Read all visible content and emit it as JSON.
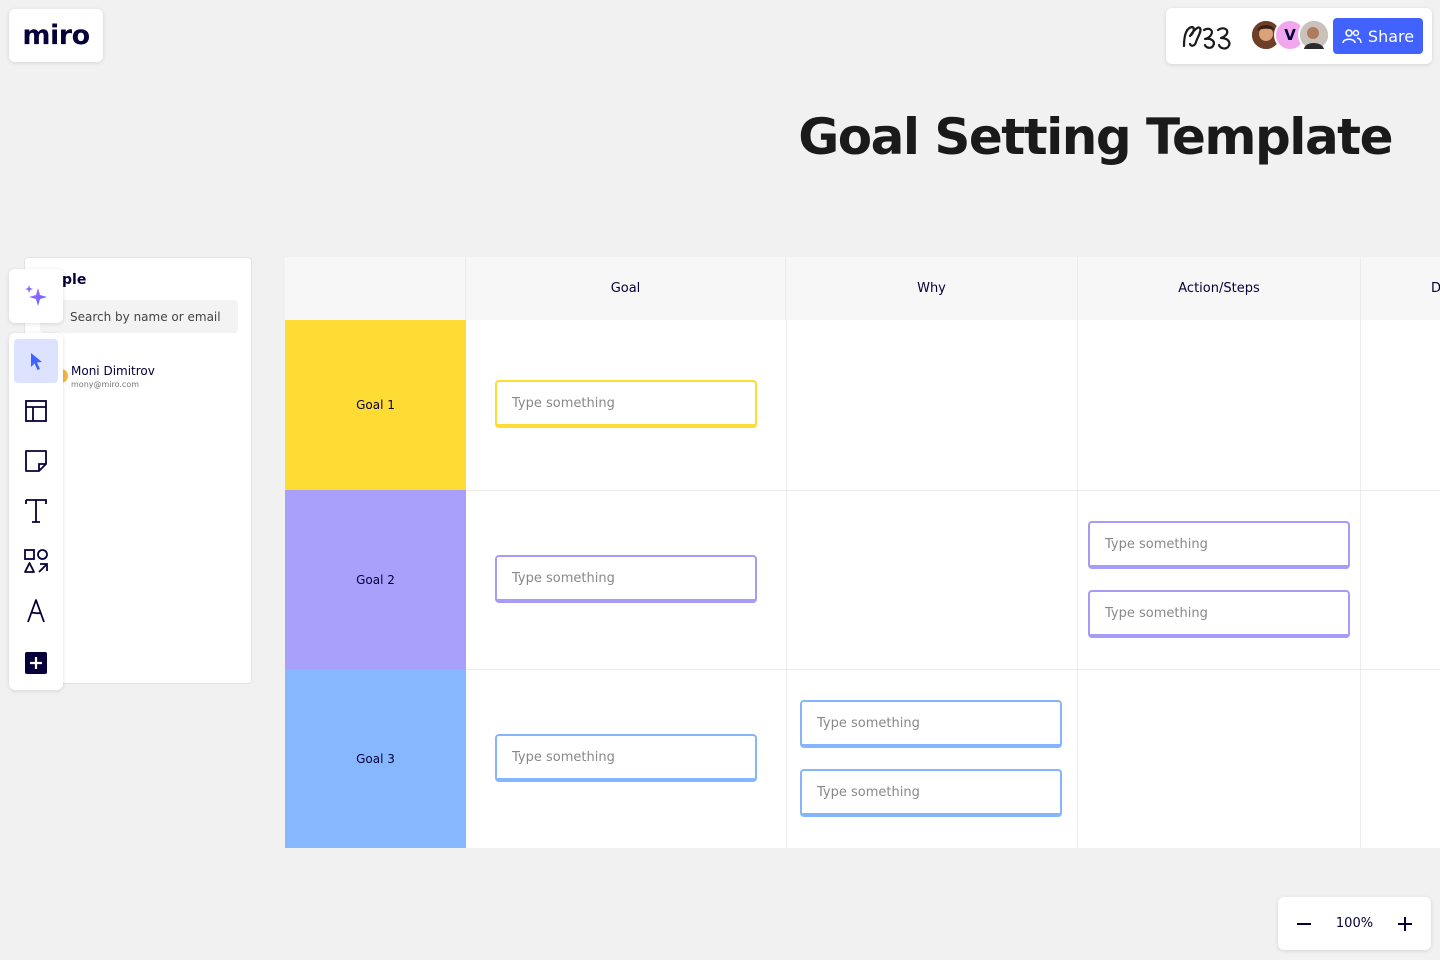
{
  "app": {
    "logo_text": "miro"
  },
  "board": {
    "title": "Goal Setting Template"
  },
  "collab": {
    "share_label": "Share",
    "avatars": [
      {
        "name": "avatar-1",
        "initial": "",
        "color": "#8a5a3c"
      },
      {
        "name": "avatar-v",
        "initial": "V",
        "color": "#f1a6ee"
      },
      {
        "name": "avatar-3",
        "initial": "",
        "color": "#9a8f88"
      }
    ]
  },
  "people_panel": {
    "title": "ple",
    "search_placeholder": "Search by name or email",
    "user": {
      "name": "Moni Dimitrov",
      "email": "mony@miro.com"
    }
  },
  "toolbar": {
    "items": [
      {
        "name": "select-tool",
        "icon": "cursor-icon",
        "active": true
      },
      {
        "name": "templates-tool",
        "icon": "templates-icon",
        "active": false
      },
      {
        "name": "sticky-note-tool",
        "icon": "sticky-note-icon",
        "active": false
      },
      {
        "name": "text-tool",
        "icon": "text-icon",
        "active": false
      },
      {
        "name": "shapes-tool",
        "icon": "shapes-icon",
        "active": false
      },
      {
        "name": "pen-tool",
        "icon": "pen-icon",
        "active": false
      },
      {
        "name": "more-tools",
        "icon": "plus-square-icon",
        "active": false
      }
    ]
  },
  "table": {
    "headers": [
      "Goal",
      "Why",
      "Action/Steps",
      "D"
    ],
    "rows": [
      {
        "label": "Goal 1",
        "color": "#ffdc33",
        "border": "#ffdc33"
      },
      {
        "label": "Goal 2",
        "color": "#a9a0fb",
        "border": "#a69cf8"
      },
      {
        "label": "Goal 3",
        "color": "#87b8ff",
        "border": "#85b5fd"
      }
    ],
    "placeholder": "Type something"
  },
  "zoom": {
    "level": "100%"
  },
  "colors": {
    "accent": "#4262ff",
    "ink": "#050038"
  }
}
